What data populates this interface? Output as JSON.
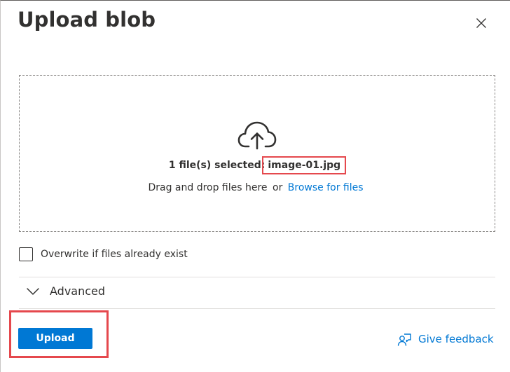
{
  "dialog": {
    "title": "Upload blob",
    "close_icon": "close-icon"
  },
  "dropzone": {
    "icon": "cloud-upload-icon",
    "selected_prefix": "1 file(s) selected:",
    "selected_file": "image-01.jpg",
    "drag_text": "Drag and drop files here",
    "or_text": "or",
    "browse_label": "Browse for files"
  },
  "options": {
    "overwrite_label": "Overwrite if files already exist",
    "overwrite_checked": false,
    "advanced_label": "Advanced",
    "advanced_expanded": false
  },
  "footer": {
    "upload_label": "Upload",
    "feedback_label": "Give feedback",
    "feedback_icon": "feedback-person-icon"
  },
  "colors": {
    "accent": "#0078d4",
    "highlight": "#e5484d",
    "text": "#323130"
  }
}
